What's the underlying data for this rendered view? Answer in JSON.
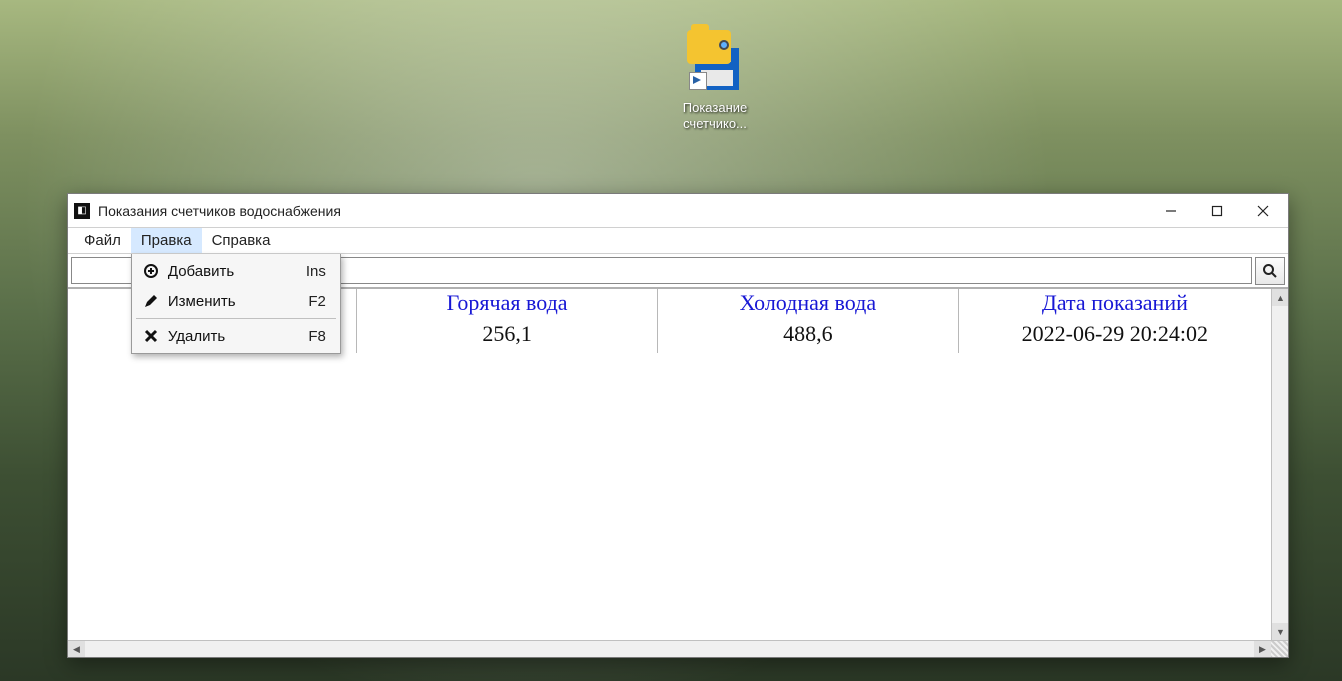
{
  "desktop_icon": {
    "label_line1": "Показание",
    "label_line2": "счетчико..."
  },
  "window": {
    "title": "Показания счетчиков водоснабжения"
  },
  "menubar": {
    "items": [
      {
        "label": "Файл"
      },
      {
        "label": "Правка"
      },
      {
        "label": "Справка"
      }
    ]
  },
  "edit_menu": {
    "add": {
      "label": "Добавить",
      "accel": "Ins"
    },
    "edit": {
      "label": "Изменить",
      "accel": "F2"
    },
    "delete": {
      "label": "Удалить",
      "accel": "F8"
    }
  },
  "toolbar": {
    "search_value": ""
  },
  "table": {
    "columns": [
      {
        "header": "№",
        "width": "24%"
      },
      {
        "header": "Горячая вода",
        "width": "25%"
      },
      {
        "header": "Холодная вода",
        "width": "25%"
      },
      {
        "header": "Дата показаний",
        "width": "26%"
      }
    ],
    "rows": [
      {
        "num": "",
        "hot": "256,1",
        "cold": "488,6",
        "date": "2022-06-29 20:24:02"
      }
    ]
  }
}
